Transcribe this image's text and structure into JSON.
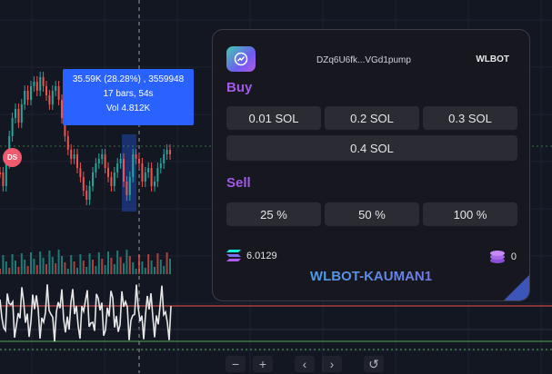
{
  "tooltip": {
    "line1": "35.59K (28.28%) , 3559948",
    "line2": "17 bars, 54s",
    "line3": "Vol 4.812K"
  },
  "ds_badge": "DS",
  "zoom_controls": [
    {
      "name": "zoom-out-button",
      "icon": "minus-icon",
      "glyph": "−"
    },
    {
      "name": "zoom-in-button",
      "icon": "plus-icon",
      "glyph": "+"
    },
    {
      "name": "scroll-left-button",
      "icon": "chevron-left-icon",
      "glyph": "‹"
    },
    {
      "name": "scroll-right-button",
      "icon": "chevron-right-icon",
      "glyph": "›"
    },
    {
      "name": "reset-button",
      "icon": "reset-icon",
      "glyph": "↺"
    }
  ],
  "panel": {
    "address": "DZq6U6fk...VGd1pump",
    "brand": "WLBOT",
    "buy_title": "Buy",
    "buy_buttons": [
      "0.01 SOL",
      "0.2 SOL",
      "0.3 SOL",
      "0.4 SOL"
    ],
    "sell_title": "Sell",
    "sell_buttons": [
      "25 %",
      "50 %",
      "100 %"
    ],
    "sol_balance": "6.0129",
    "token_balance": "0",
    "account_name": "WLBOT-KAUMAN1"
  },
  "colors": {
    "background": "#131722",
    "candle_up": "#26a69a",
    "candle_down": "#ef5350",
    "tooltip": "#2962ff",
    "accent_purple": "#a259e6",
    "panel_bg": "#16171f"
  }
}
